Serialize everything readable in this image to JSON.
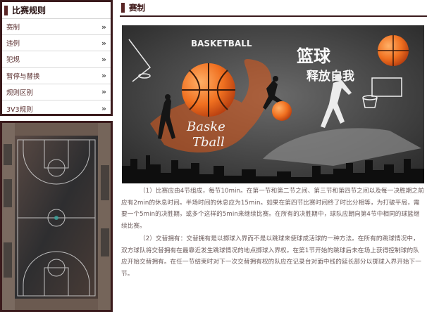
{
  "sidebar": {
    "title": "比赛规则",
    "items": [
      {
        "label": "赛制",
        "arrow": "»"
      },
      {
        "label": "违例",
        "arrow": "»"
      },
      {
        "label": "犯规",
        "arrow": "»"
      },
      {
        "label": "暂停与替换",
        "arrow": "»"
      },
      {
        "label": "规则区别",
        "arrow": "»"
      },
      {
        "label": "3V3规则",
        "arrow": "»"
      }
    ]
  },
  "main": {
    "title": "赛制",
    "banner": {
      "text_basketball_arc": "BASKETBALL",
      "text_cn_line1": "篮球",
      "text_cn_line2": "释放自我",
      "text_script_line1": "Baske",
      "text_script_line2": "Tball"
    },
    "paragraphs": [
      "（1）比赛应由4节组成，每节10min。在第一节和第二节之间、第三节和第四节之间以及每一决胜期之前应有2min的休息时间。半场时间的休息应为15min。如果在第四节比赛时间终了时比分相等，为打破平局，需要一个5min的决胜期，或多个这样的5min来继续比赛。在所有的决胜期中，球队应朝向第4节中相同的球篮继续比赛。",
      "（2）交替拥有：交替拥有是以掷球入界而不是以跳球来使球成活球的一种方法。在所有的跳球情况中，双方球队将交替拥有在最靠近发生跳球情况的地点掷球入界权。在第1节开始的跳球后未在场上获得控制球的队应开始交替拥有。在任一节结束时对下一次交替拥有权的队应在记录台对面中线的延长部分以掷球入界开始下一节。"
    ]
  }
}
